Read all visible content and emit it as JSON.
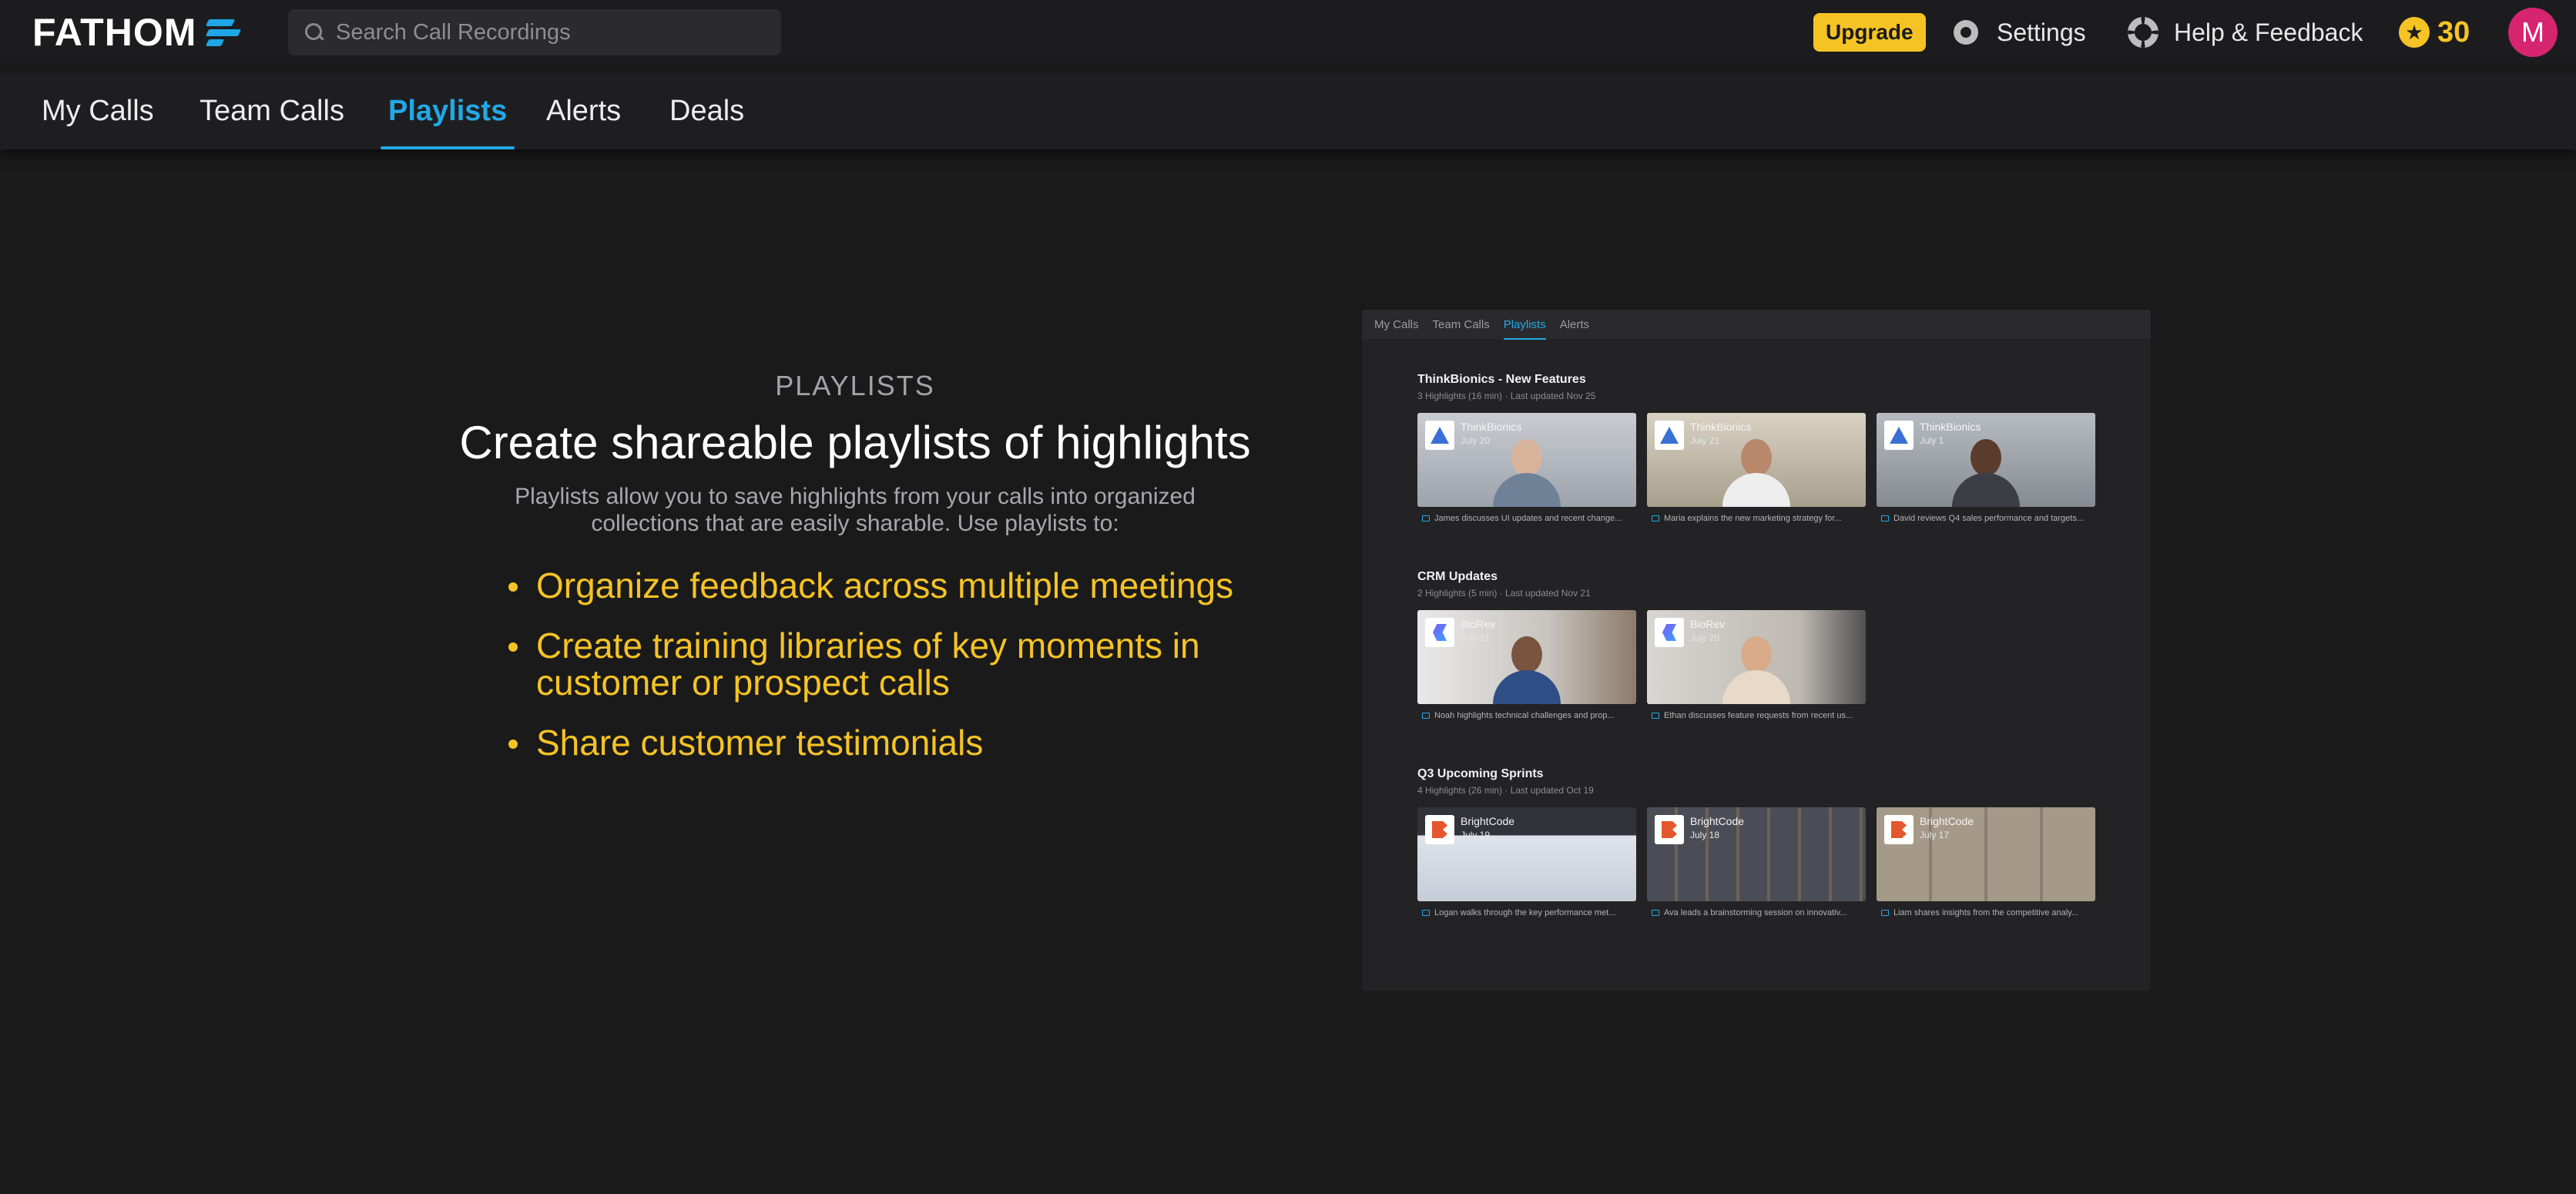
{
  "app": {
    "logo_text": "FATHOM",
    "search_placeholder": "Search Call Recordings",
    "upgrade_label": "Upgrade",
    "settings_label": "Settings",
    "help_label": "Help & Feedback",
    "points": "30",
    "avatar_initial": "M"
  },
  "nav": {
    "tabs": [
      {
        "label": "My Calls",
        "active": false
      },
      {
        "label": "Team Calls",
        "active": false
      },
      {
        "label": "Playlists",
        "active": true
      },
      {
        "label": "Alerts",
        "active": false
      },
      {
        "label": "Deals",
        "active": false
      }
    ]
  },
  "main": {
    "eyebrow": "PLAYLISTS",
    "headline": "Create shareable playlists of highlights",
    "description": "Playlists allow you to save highlights from your calls into organized collections that are easily sharable. Use playlists to:",
    "bullets": [
      "Organize feedback across multiple meetings",
      "Create training libraries of key moments in customer or prospect calls",
      "Share customer testimonials"
    ]
  },
  "preview": {
    "tabs": [
      "My Calls",
      "Team Calls",
      "Playlists",
      "Alerts"
    ],
    "active_tab": "Playlists",
    "playlists": [
      {
        "title": "ThinkBionics - New Features",
        "meta": "3 Highlights (16 min) · Last updated Nov 25",
        "cards": [
          {
            "brand": "ThinkBionics",
            "date": "July 20",
            "caption": "James discusses UI updates and recent change..."
          },
          {
            "brand": "ThinkBionics",
            "date": "July 21",
            "caption": "Maria explains the new marketing strategy for..."
          },
          {
            "brand": "ThinkBionics",
            "date": "July 1",
            "caption": "David reviews Q4 sales performance and targets..."
          }
        ]
      },
      {
        "title": "CRM Updates",
        "meta": "2 Highlights (5 min) · Last updated Nov 21",
        "cards": [
          {
            "brand": "BioRev",
            "date": "July 21",
            "caption": "Noah highlights technical challenges and prop..."
          },
          {
            "brand": "BioRev",
            "date": "July 20",
            "caption": "Ethan discusses feature requests from recent us..."
          }
        ]
      },
      {
        "title": "Q3 Upcoming Sprints",
        "meta": "4 Highlights (26 min) · Last updated Oct 19",
        "cards": [
          {
            "brand": "BrightCode",
            "date": "July 19",
            "caption": "Logan walks through the key performance met..."
          },
          {
            "brand": "BrightCode",
            "date": "July 18",
            "caption": "Ava leads a brainstorming session on innovativ..."
          },
          {
            "brand": "BrightCode",
            "date": "July 17",
            "caption": "Liam shares insights from the competitive analy..."
          }
        ]
      }
    ]
  },
  "colors": {
    "accent": "#23a8e6",
    "highlight": "#f5c324",
    "avatar": "#d6246e",
    "background": "#1a1a1a"
  }
}
